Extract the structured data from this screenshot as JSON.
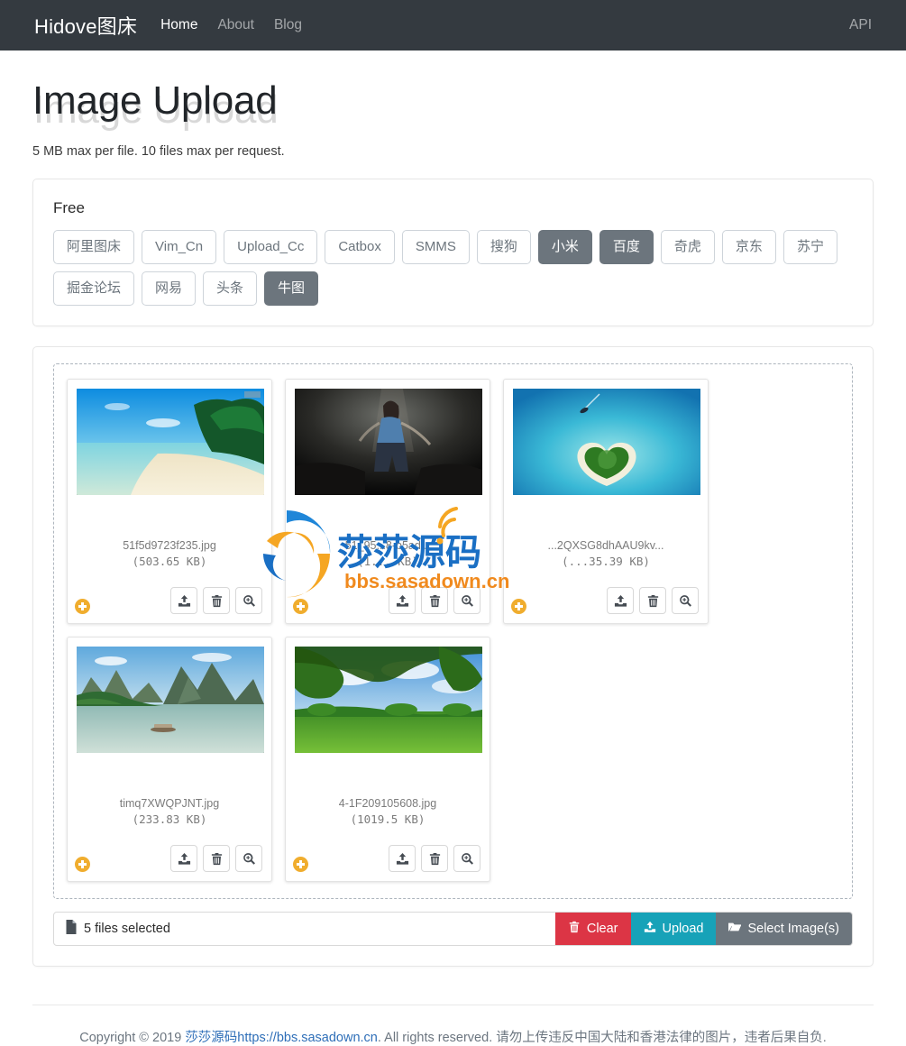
{
  "navbar": {
    "brand": "Hidove图床",
    "links": [
      {
        "label": "Home",
        "active": true
      },
      {
        "label": "About",
        "active": false
      },
      {
        "label": "Blog",
        "active": false
      }
    ],
    "right_link": "API",
    "bg_color": "#343a40"
  },
  "header": {
    "title": "Image Upload",
    "subtitle": "5 MB max per file. 10 files max per request."
  },
  "hosts_panel": {
    "group_label": "Free",
    "buttons": [
      {
        "label": "阿里图床",
        "active": false
      },
      {
        "label": "Vim_Cn",
        "active": false
      },
      {
        "label": "Upload_Cc",
        "active": false
      },
      {
        "label": "Catbox",
        "active": false
      },
      {
        "label": "SMMS",
        "active": false
      },
      {
        "label": "搜狗",
        "active": false
      },
      {
        "label": "小米",
        "active": true
      },
      {
        "label": "百度",
        "active": true
      },
      {
        "label": "奇虎",
        "active": false
      },
      {
        "label": "京东",
        "active": false
      },
      {
        "label": "苏宁",
        "active": false
      },
      {
        "label": "掘金论坛",
        "active": false
      },
      {
        "label": "网易",
        "active": false
      },
      {
        "label": "头条",
        "active": false
      },
      {
        "label": "牛图",
        "active": true
      }
    ],
    "active_color": "#6c757d",
    "inactive_text_color": "#6c757d"
  },
  "files": [
    {
      "name": "51f5d9723f235.jpg",
      "size": "(503.65 KB)",
      "thumb": "beach-palm-trees",
      "actions": [
        "upload-icon",
        "trash-icon",
        "zoom-in-icon"
      ],
      "add_badge": "plus-badge"
    },
    {
      "name": "51_95...8-b5ad...",
      "size": "(1... KB)",
      "thumb": "dark-figure-cave",
      "actions": [
        "upload-icon",
        "trash-icon",
        "zoom-in-icon"
      ],
      "add_badge": "plus-badge"
    },
    {
      "name": "...2QXSG8dhAAU9kv...",
      "size": "(...35.39 KB)",
      "thumb": "heart-island-turquoise",
      "actions": [
        "upload-icon",
        "trash-icon",
        "zoom-in-icon"
      ],
      "add_badge": "plus-badge"
    },
    {
      "name": "timq7XWQPJNT.jpg",
      "size": "(233.83 KB)",
      "thumb": "guilin-river-karst",
      "actions": [
        "upload-icon",
        "trash-icon",
        "zoom-in-icon"
      ],
      "add_badge": "plus-badge"
    },
    {
      "name": "4-1F209105608.jpg",
      "size": "(1019.5 KB)",
      "thumb": "green-meadow-trees",
      "actions": [
        "upload-icon",
        "trash-icon",
        "zoom-in-icon"
      ],
      "add_badge": "plus-badge"
    }
  ],
  "watermark": {
    "text_cn": "莎莎源码",
    "text_url": "bbs.sasadown.cn",
    "blue": "#1a6fc4",
    "orange": "#f08a1e"
  },
  "bottom_bar": {
    "status": "5 files selected",
    "status_icon": "file-icon",
    "clear": {
      "label": "Clear",
      "icon": "trash-icon",
      "color": "#dc3545"
    },
    "upload": {
      "label": "Upload",
      "icon": "upload-icon",
      "color": "#17a2b8"
    },
    "select": {
      "label": "Select Image(s)",
      "icon": "folder-open-icon",
      "color": "#6c757d"
    }
  },
  "footer": {
    "prefix": "Copyright © 2019 ",
    "link": "莎莎源码https://bbs.sasadown.cn",
    "suffix": ". All rights reserved. 请勿上传违反中国大陆和香港法律的图片，违者后果自负."
  }
}
